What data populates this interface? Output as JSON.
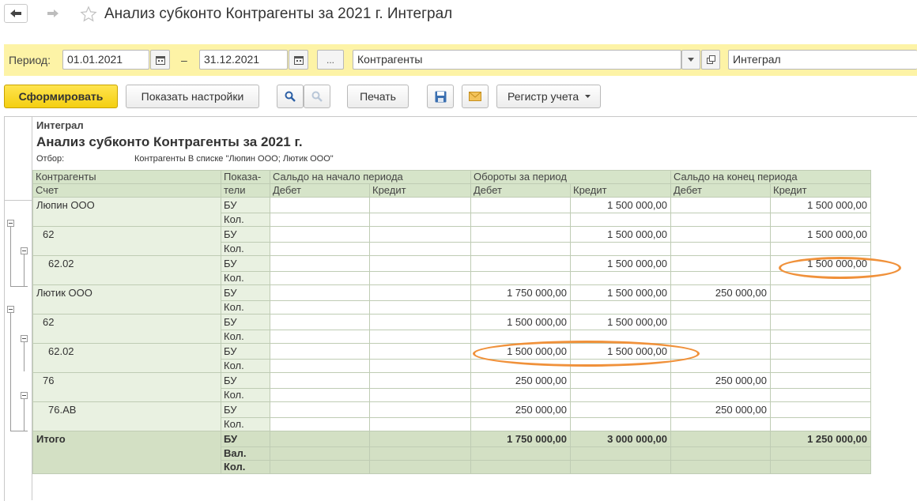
{
  "window": {
    "title": "Анализ субконто Контрагенты за 2021 г. Интеграл"
  },
  "period_bar": {
    "period_label": "Период:",
    "date_from": "01.01.2021",
    "dash": "–",
    "date_to": "31.12.2021",
    "ellipsis_label": "...",
    "subconto_type": "Контрагенты",
    "organization": "Интеграл"
  },
  "toolbar": {
    "generate_label": "Сформировать",
    "show_settings_label": "Показать настройки",
    "print_label": "Печать",
    "register_label": "Регистр учета"
  },
  "report": {
    "org": "Интеграл",
    "title": "Анализ субконто Контрагенты за 2021 г.",
    "filter_label": "Отбор:",
    "filter_value": "Контрагенты В списке \"Люпин ООО; Лютик ООО\"",
    "headers": {
      "col1_top": "Контрагенты",
      "col1_bottom": "Счет",
      "col2_top": "Показа-",
      "col2_bottom": "тели",
      "opening": "Сальдо на начало периода",
      "turnover": "Обороты за период",
      "closing": "Сальдо на конец периода",
      "debit": "Дебет",
      "credit": "Кредит"
    },
    "rows": [
      {
        "account": "Люпин ООО",
        "ind": "БУ",
        "ind2": "Кол.",
        "od": "",
        "oc": "",
        "td": "",
        "tc": "1 500 000,00",
        "cd": "",
        "cc": "1 500 000,00"
      },
      {
        "account": "62",
        "ind": "БУ",
        "ind2": "Кол.",
        "od": "",
        "oc": "",
        "td": "",
        "tc": "1 500 000,00",
        "cd": "",
        "cc": "1 500 000,00"
      },
      {
        "account": "62.02",
        "ind": "БУ",
        "ind2": "Кол.",
        "od": "",
        "oc": "",
        "td": "",
        "tc": "1 500 000,00",
        "cd": "",
        "cc": "1 500 000,00"
      },
      {
        "account": "Лютик ООО",
        "ind": "БУ",
        "ind2": "Кол.",
        "od": "",
        "oc": "",
        "td": "1 750 000,00",
        "tc": "1 500 000,00",
        "cd": "250 000,00",
        "cc": ""
      },
      {
        "account": "62",
        "ind": "БУ",
        "ind2": "Кол.",
        "od": "",
        "oc": "",
        "td": "1 500 000,00",
        "tc": "1 500 000,00",
        "cd": "",
        "cc": ""
      },
      {
        "account": "62.02",
        "ind": "БУ",
        "ind2": "Кол.",
        "od": "",
        "oc": "",
        "td": "1 500 000,00",
        "tc": "1 500 000,00",
        "cd": "",
        "cc": ""
      },
      {
        "account": "76",
        "ind": "БУ",
        "ind2": "Кол.",
        "od": "",
        "oc": "",
        "td": "250 000,00",
        "tc": "",
        "cd": "250 000,00",
        "cc": ""
      },
      {
        "account": "76.АВ",
        "ind": "БУ",
        "ind2": "Кол.",
        "od": "",
        "oc": "",
        "td": "250 000,00",
        "tc": "",
        "cd": "250 000,00",
        "cc": ""
      }
    ],
    "total": {
      "label": "Итого",
      "ind1": "БУ",
      "ind2": "Вал.",
      "ind3": "Кол.",
      "od": "",
      "oc": "",
      "td": "1 750 000,00",
      "tc": "3 000 000,00",
      "cd": "",
      "cc": "1 250 000,00"
    }
  },
  "colors": {
    "period_bar_bg": "#fdf3a6",
    "generate_button": "#f4cf11",
    "header_bg": "#d6e4c9",
    "highlight_ellipse": "#f0913a"
  },
  "icons": [
    "back-arrow-icon",
    "forward-arrow-icon",
    "favorite-star-icon",
    "calendar-icon",
    "dropdown-arrow-icon",
    "open-form-icon",
    "search-icon",
    "search-cancel-icon",
    "save-icon",
    "email-icon",
    "dropdown-arrow-icon",
    "tree-collapse-icon"
  ]
}
